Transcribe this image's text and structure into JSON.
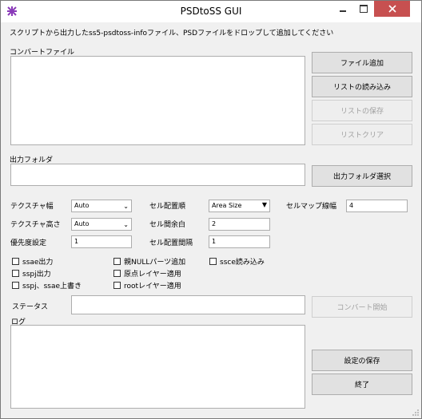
{
  "window": {
    "title": "PSDtoSS GUI"
  },
  "instruction": "スクリプトから出力したss5-psdtoss-infoファイル、PSDファイルをドロップして追加してください",
  "convert_files": {
    "label": "コンバートファイル"
  },
  "buttons": {
    "add_file": "ファイル追加",
    "load_list": "リストの読み込み",
    "save_list": "リストの保存",
    "clear_list": "リストクリア",
    "select_output": "出力フォルダ選択",
    "convert_start": "コンバート開始",
    "save_settings": "設定の保存",
    "exit": "終了"
  },
  "output_folder": {
    "label": "出力フォルダ",
    "value": ""
  },
  "settings": {
    "texture_width": {
      "label": "テクスチャ幅",
      "value": "Auto"
    },
    "texture_height": {
      "label": "テクスチャ高さ",
      "value": "Auto"
    },
    "priority": {
      "label": "優先度設定",
      "value": "1"
    },
    "cell_order": {
      "label": "セル配置順",
      "value": "Area Size"
    },
    "cell_margin": {
      "label": "セル間余白",
      "value": "2"
    },
    "cell_spacing": {
      "label": "セル配置間隔",
      "value": "1"
    },
    "cellmap_line_width": {
      "label": "セルマップ線幅",
      "value": "4"
    }
  },
  "checkboxes": {
    "ssae_output": "ssae出力",
    "sspj_output": "sspj出力",
    "overwrite": "sspj、ssae上書き",
    "parent_null": "親NULLパーツ追加",
    "origin_layer": "原点レイヤー適用",
    "root_layer": "rootレイヤー適用",
    "ssce_read": "ssce読み込み"
  },
  "status": {
    "label": "ステータス",
    "value": ""
  },
  "log": {
    "label": "ログ"
  },
  "colors": {
    "close_button": "#c75050",
    "app_icon": "#8a3ab9"
  }
}
